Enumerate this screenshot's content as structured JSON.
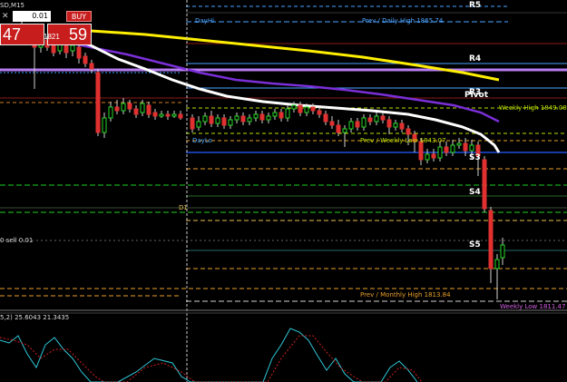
{
  "symbol": "SD,M15",
  "trade_panel": {
    "lot": "0.01",
    "buy_label": "BUY",
    "sell_price": "47",
    "buy_price": "59",
    "spread": "1821"
  },
  "levels": {
    "r5": "R5",
    "r4": "R4",
    "r3": "R3",
    "pivot": "Pivot",
    "s3": "S3",
    "s4": "S4",
    "s5": "S5",
    "d1": "D1"
  },
  "labels": {
    "day_hi": "DayHi",
    "day_lo": "DayLo",
    "prev_daily_high": "Prev / Daily High 1865.74",
    "prev_weekly_low": "Prev / Weekly Low 1843.07",
    "weekly_high": "Weekly High 1849.08",
    "prev_monthly_high": "Prev / Monthly High 1813.84",
    "weekly_low": "Weekly Low 1811.47",
    "sell_line": "0 sell 0.01",
    "indicator_info": "5,2) 25.6043 21.3435"
  },
  "colors": {
    "background": "#000000",
    "bull_candle": "#26d926",
    "bear_candle": "#e03030",
    "ma_yellow": "#ffef00",
    "ma_white": "#ffffff",
    "ma_purple": "#8a2be2",
    "sell_red": "#c71d1d"
  }
}
